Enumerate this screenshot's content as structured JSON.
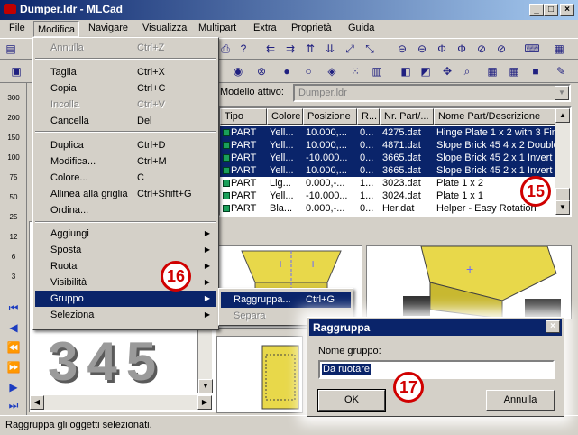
{
  "window": {
    "title": "Dumper.ldr - MLCad",
    "min": "_",
    "max": "□",
    "close": "×"
  },
  "menubar": [
    "File",
    "Modifica",
    "Navigare",
    "Visualizza",
    "Multipart",
    "Extra",
    "Proprietà",
    "Guida"
  ],
  "edit_menu": {
    "items": [
      {
        "label": "Annulla",
        "shortcut": "Ctrl+Z",
        "disabled": true
      },
      {
        "label": "Taglia",
        "shortcut": "Ctrl+X"
      },
      {
        "label": "Copia",
        "shortcut": "Ctrl+C"
      },
      {
        "label": "Incolla",
        "shortcut": "Ctrl+V",
        "disabled": true
      },
      {
        "label": "Cancella",
        "shortcut": "Del"
      },
      {
        "label": "Duplica",
        "shortcut": "Ctrl+D"
      },
      {
        "label": "Modifica...",
        "shortcut": "Ctrl+M"
      },
      {
        "label": "Colore...",
        "shortcut": "C"
      },
      {
        "label": "Allinea alla griglia",
        "shortcut": "Ctrl+Shift+G"
      },
      {
        "label": "Ordina..."
      },
      {
        "label": "Aggiungi",
        "submenu": true
      },
      {
        "label": "Sposta",
        "submenu": true
      },
      {
        "label": "Ruota",
        "submenu": true
      },
      {
        "label": "Visibilità",
        "submenu": true
      },
      {
        "label": "Gruppo",
        "submenu": true,
        "highlighted": true
      },
      {
        "label": "Seleziona",
        "submenu": true
      }
    ]
  },
  "group_submenu": {
    "items": [
      {
        "label": "Raggruppa...",
        "shortcut": "Ctrl+G",
        "highlighted": true
      },
      {
        "label": "Separa",
        "disabled": true
      }
    ]
  },
  "model": {
    "label": "Modello attivo:",
    "value": "Dumper.ldr"
  },
  "parts_table": {
    "columns": [
      "Tipo",
      "Colore",
      "Posizione",
      "R...",
      "Nr. Part/...",
      "Nome Part/Descrizione"
    ],
    "rows": [
      {
        "tipo": "PART",
        "colore": "Yell...",
        "pos": "10.000,...",
        "r": "0...",
        "nr": "4275.dat",
        "nome": "Hinge Plate  1 x 2 with 3 Fin",
        "selected": true
      },
      {
        "tipo": "PART",
        "colore": "Yell...",
        "pos": "10.000,...",
        "r": "0...",
        "nr": "4871.dat",
        "nome": "Slope Brick 45  4 x 2 Double",
        "selected": true
      },
      {
        "tipo": "PART",
        "colore": "Yell...",
        "pos": "-10.000...",
        "r": "0...",
        "nr": "3665.dat",
        "nome": "Slope Brick 45  2 x 1 Invert",
        "selected": true
      },
      {
        "tipo": "PART",
        "colore": "Yell...",
        "pos": "10.000,...",
        "r": "0...",
        "nr": "3665.dat",
        "nome": "Slope Brick 45  2 x 1 Invert",
        "selected": true
      },
      {
        "tipo": "PART",
        "colore": "Lig...",
        "pos": "0.000,-...",
        "r": "1...",
        "nr": "3023.dat",
        "nome": "Plate  1 x  2",
        "selected": false
      },
      {
        "tipo": "PART",
        "colore": "Yell...",
        "pos": "-10.000...",
        "r": "1...",
        "nr": "3024.dat",
        "nome": "Plate  1 x  1",
        "selected": false
      },
      {
        "tipo": "PART",
        "colore": "Bla...",
        "pos": "0.000,-...",
        "r": "0...",
        "nr": "Her.dat",
        "nome": "Helper - Easy Rotation",
        "selected": false
      }
    ]
  },
  "zoom_buttons": [
    "300",
    "200",
    "150",
    "100",
    "75",
    "50",
    "25",
    "12",
    "6",
    "3"
  ],
  "dialog": {
    "title": "Raggruppa",
    "field_label": "Nome gruppo:",
    "field_value": "Da ruotare",
    "ok": "OK",
    "cancel": "Annulla"
  },
  "badges": [
    "15",
    "16",
    "17"
  ],
  "preview_digits": "345",
  "status": "Raggruppa gli oggetti selezionati.",
  "colors": {
    "title_bar": "#0a246a",
    "selection": "#0a246a",
    "badge": "#d00000",
    "face": "#d4d0c8",
    "part_yellow": "#e8d84a"
  }
}
